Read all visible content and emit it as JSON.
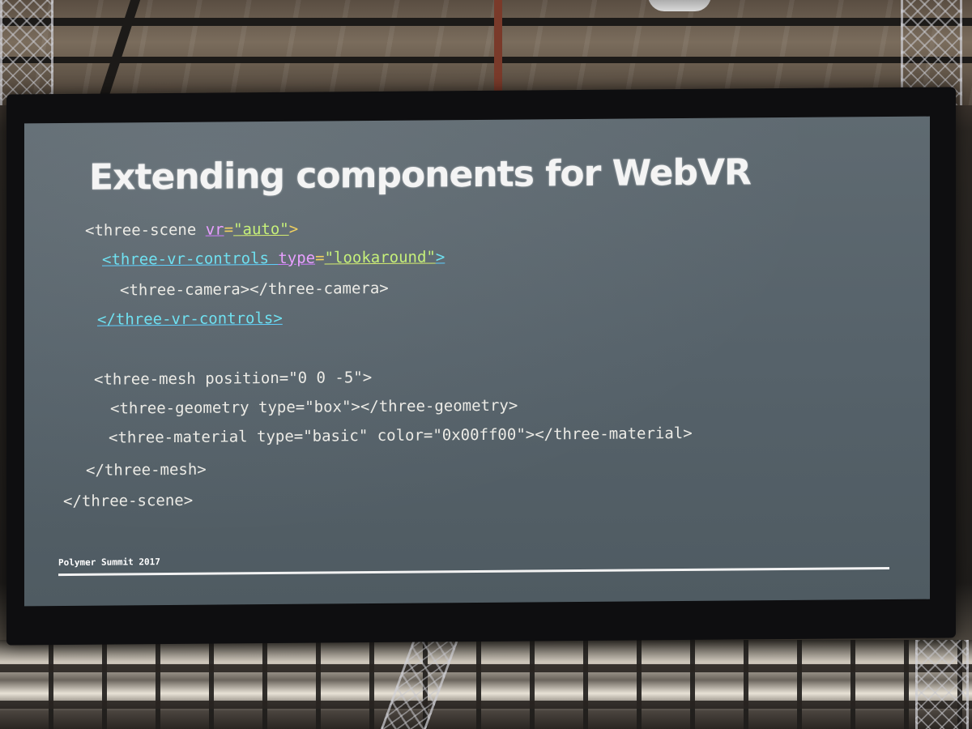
{
  "slide": {
    "title": "Extending components for WebVR",
    "footer": "Polymer Summit 2017"
  },
  "code": {
    "l1": {
      "text": "<three-scene ",
      "attr": "vr",
      "eq": "=",
      "val": "\"auto\"",
      "close": ">"
    },
    "l2": {
      "tag": "<three-vr-controls ",
      "attr": "type",
      "eq": "=",
      "val": "\"lookaround\"",
      "close": ">"
    },
    "l3": "<three-camera></three-camera>",
    "l4": "</three-vr-controls>",
    "l5": "<three-mesh position=\"0 0 -5\">",
    "l6": "<three-geometry type=\"box\"></three-geometry>",
    "l7": "<three-material type=\"basic\" color=\"0x00ff00\"></three-material>",
    "l8": "</three-mesh>",
    "l9": "</three-scene>"
  },
  "colors": {
    "slide_background": "#56626a",
    "text": "#ecebe6",
    "highlight_tag": "#6fe0f0",
    "highlight_attr": "#e8a0ff",
    "highlight_value": "#c6f07a"
  }
}
